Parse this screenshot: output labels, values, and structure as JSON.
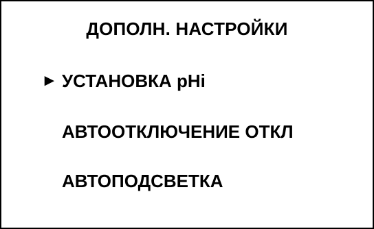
{
  "screen": {
    "title": "ДОПОЛН. НАСТРОЙКИ"
  },
  "menu": {
    "cursor_glyph": "►",
    "selected_index": 0,
    "items": [
      {
        "label": "УСТАНОВКА pHi"
      },
      {
        "label": "АВТООТКЛЮЧЕНИЕ ОТКЛ"
      },
      {
        "label": "АВТОПОДСВЕТКА"
      }
    ]
  },
  "colors": {
    "background": "#ffffff",
    "text": "#000000",
    "border": "#000000"
  }
}
